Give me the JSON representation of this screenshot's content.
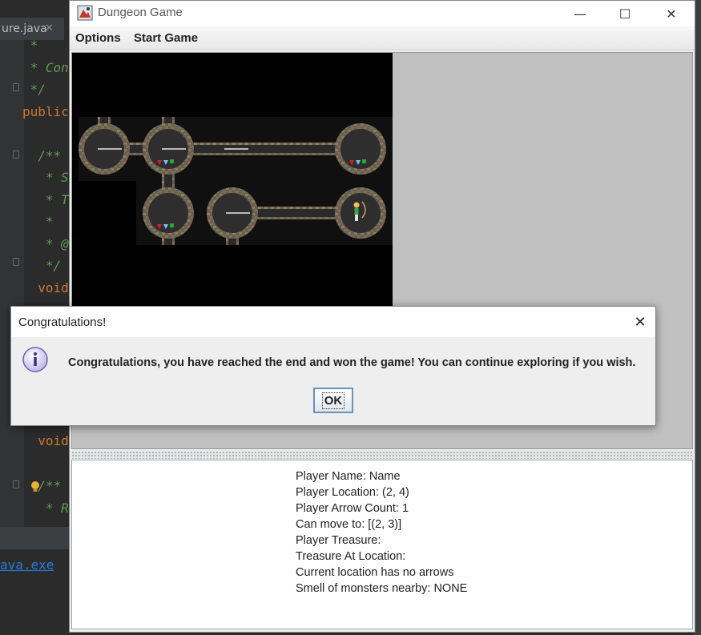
{
  "ide": {
    "tab_label": "ure.java",
    "tab_close": "✕",
    "code_lines": [
      {
        "text": " *",
        "cls": "cmt"
      },
      {
        "text": " * Con",
        "cls": "cmt"
      },
      {
        "text": " */",
        "cls": "cmt"
      },
      {
        "text": "public",
        "cls": "kw"
      },
      {
        "text": "",
        "cls": "cmt"
      },
      {
        "text": "  /**",
        "cls": "cmt"
      },
      {
        "text": "   * S",
        "cls": "cmt"
      },
      {
        "text": "   * T",
        "cls": "cmt"
      },
      {
        "text": "   *",
        "cls": "cmt"
      },
      {
        "text": "   * @",
        "cls": "cmt"
      },
      {
        "text": "   */",
        "cls": "cmt"
      },
      {
        "text": "  void",
        "cls": "kw"
      }
    ],
    "lower_code_lines": [
      {
        "text": "  void",
        "cls": "kw"
      },
      {
        "text": "",
        "cls": "cmt"
      },
      {
        "text": "  /**",
        "cls": "cmt"
      },
      {
        "text": "   * R",
        "cls": "cmt"
      }
    ],
    "run_link": "ava.exe"
  },
  "window": {
    "title": "Dungeon Game",
    "minimize": "—",
    "maximize": "☐",
    "close": "✕"
  },
  "menu": {
    "options": "Options",
    "start_game": "Start Game"
  },
  "dialog": {
    "title": "Congratulations!",
    "close": "✕",
    "message": "Congratulations, you have reached the end and won the game! You can continue exploring if you wish.",
    "ok_label": "OK"
  },
  "info": {
    "player_name": "Player Name: Name",
    "player_location": "Player Location: (2, 4)",
    "arrow_count": "Player Arrow Count: 1",
    "can_move": "Can move to: [(2, 3)]",
    "player_treasure": "Player Treasure:",
    "treasure_at_location": "Treasure At Location:",
    "location_arrows": "Current location has no arrows",
    "smell": "Smell of monsters nearby: NONE"
  },
  "colors": {
    "map_background": "#000000",
    "panel_background": "#c0c0c0",
    "ok_border": "#6d8fb8",
    "ruby": "#d62020",
    "diamond": "#6ec6ff",
    "emerald": "#22aa33"
  }
}
